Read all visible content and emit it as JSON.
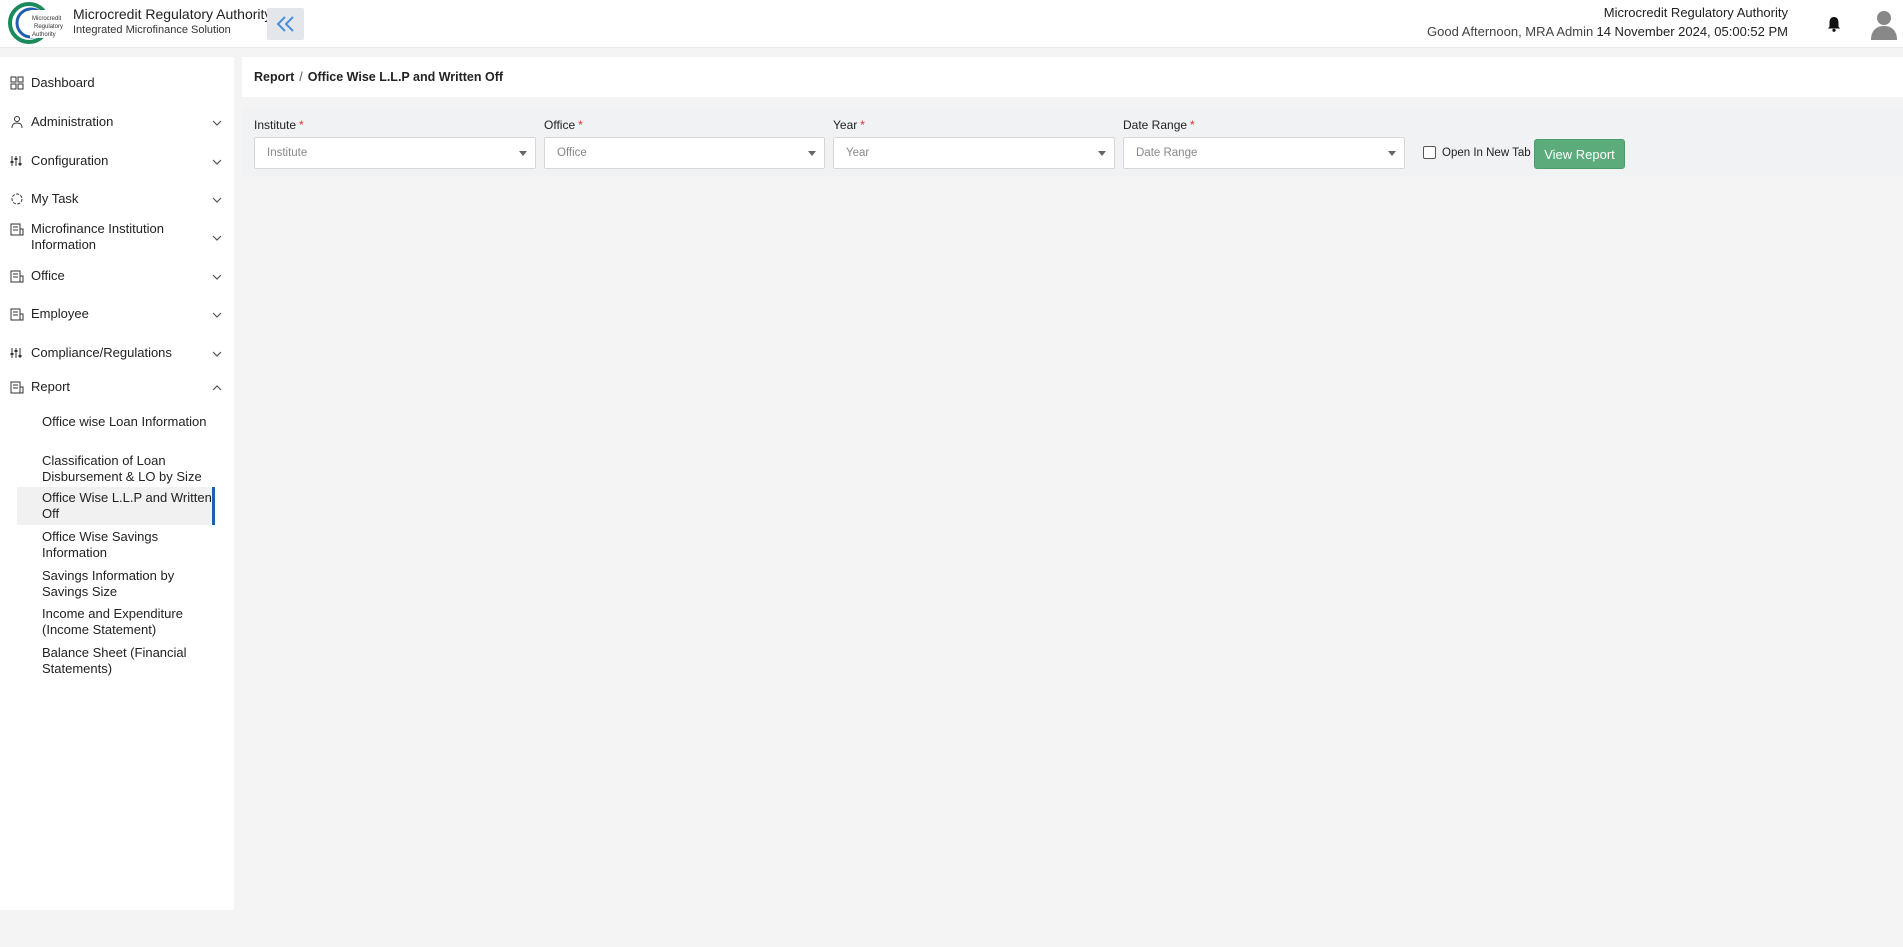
{
  "header": {
    "app_title": "Microcredit Regulatory Authority",
    "app_subtitle": "Integrated Microfinance Solution",
    "logo_text_1": "Microcredit",
    "logo_text_2": "Regulatory",
    "logo_text_3": "Authority",
    "greeting": "Good Afternoon, MRA Admin",
    "org_name": "Microcredit Regulatory Authority",
    "datetime": "14 November 2024, 05:00:52 PM"
  },
  "sidebar": {
    "items": [
      {
        "label": "Dashboard",
        "icon": "grid-icon",
        "has_chevron": false
      },
      {
        "label": "Administration",
        "icon": "users-icon",
        "has_chevron": true
      },
      {
        "label": "Configuration",
        "icon": "sliders-icon",
        "has_chevron": true
      },
      {
        "label": "My Task",
        "icon": "circle-icon",
        "has_chevron": true
      },
      {
        "label": "Microfinance Institution Information",
        "icon": "building-icon",
        "has_chevron": true
      },
      {
        "label": "Office",
        "icon": "building-icon",
        "has_chevron": true
      },
      {
        "label": "Employee",
        "icon": "building-icon",
        "has_chevron": true
      },
      {
        "label": "Compliance/Regulations",
        "icon": "sliders-icon",
        "has_chevron": true
      },
      {
        "label": "Report",
        "icon": "building-icon",
        "has_chevron": true,
        "expanded": true
      }
    ],
    "report_sub": [
      "Office wise Loan Information",
      "Classification of Loan Disbursement & LO by Size",
      "Office Wise L.L.P and Written Off",
      "Office Wise Savings Information",
      "Savings Information by Savings Size",
      "Income and Expenditure (Income Statement)",
      "Balance Sheet (Financial Statements)"
    ],
    "active_sub": "Office Wise L.L.P and Written Off"
  },
  "breadcrumb": {
    "root": "Report",
    "separator": "/",
    "current": "Office Wise L.L.P and Written Off"
  },
  "filters": {
    "institute": {
      "label": "Institute",
      "placeholder": "Institute"
    },
    "office": {
      "label": "Office",
      "placeholder": "Office"
    },
    "year": {
      "label": "Year",
      "placeholder": "Year"
    },
    "date_range": {
      "label": "Date Range",
      "placeholder": "Date Range"
    },
    "required_mark": "*",
    "open_new_tab_label": "Open In New Tab",
    "view_report_label": "View Report"
  },
  "colors": {
    "accent": "#1f5fae",
    "button": "#5cac7b",
    "required": "#dd3333"
  }
}
